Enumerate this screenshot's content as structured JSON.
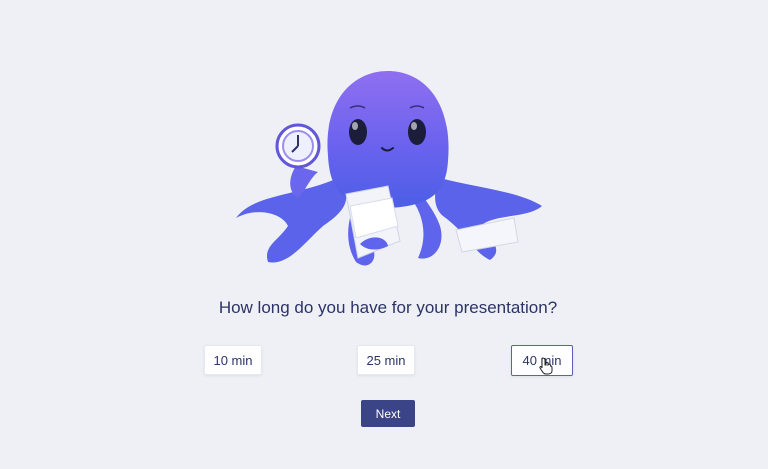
{
  "question": "How long do you have for your presentation?",
  "options": [
    {
      "label": "10 min",
      "selected": false
    },
    {
      "label": "25 min",
      "selected": false
    },
    {
      "label": "40 min",
      "selected": true
    }
  ],
  "next_label": "Next",
  "colors": {
    "background": "#eef0f5",
    "text": "#2d3366",
    "button": "#3b4486",
    "selected_border": "#5a60b8",
    "mascot": "#6e6cf0"
  },
  "icons": [
    "octopus-illustration",
    "clock-icon",
    "paper-icon",
    "hand-cursor-icon"
  ]
}
